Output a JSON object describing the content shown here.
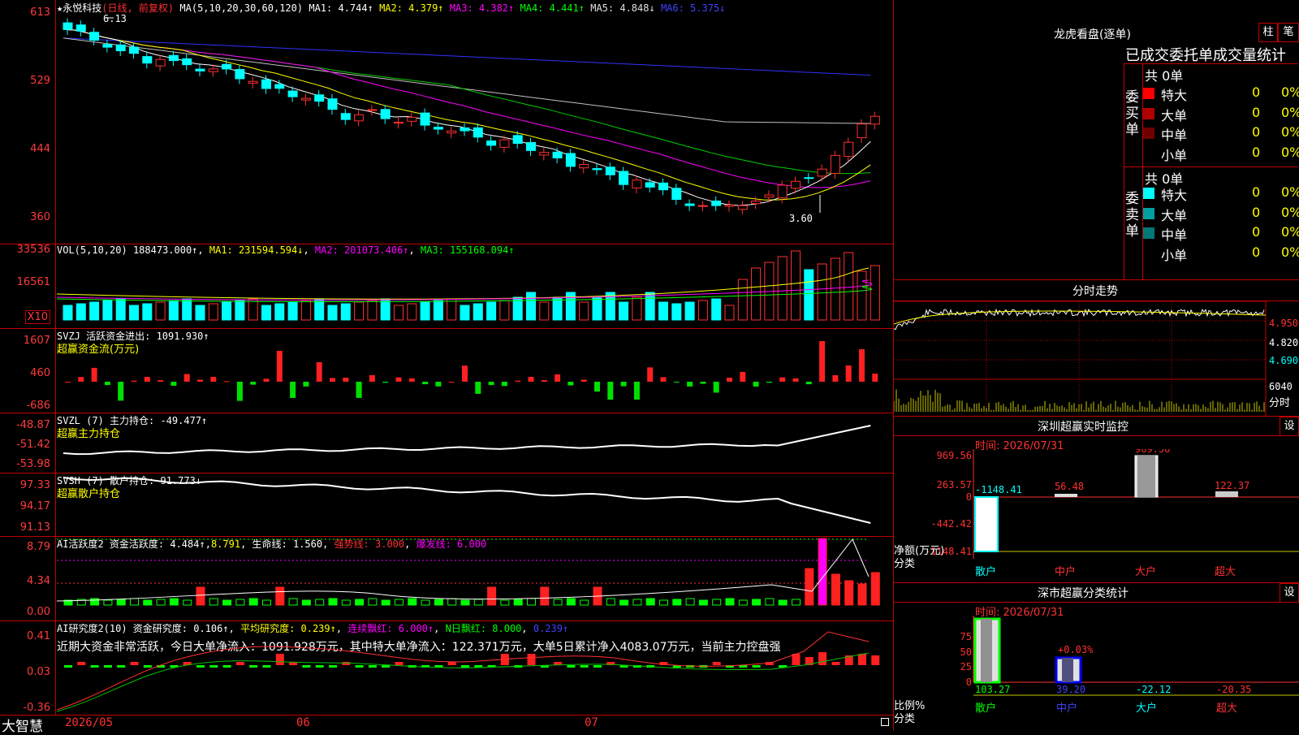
{
  "price_panel": {
    "title_star": "★",
    "stock_name": "永悦科技",
    "period": "(日线, 前复权)",
    "ma_label": "MA(5,10,20,30,60,120)",
    "ma1": "MA1: 4.744↑",
    "ma2": "MA2: 4.379↑",
    "ma3": "MA3: 4.382↑",
    "ma4": "MA4: 4.441↑",
    "ma5": "MA5: 4.848↓",
    "ma6": "MA6: 5.375↓",
    "high_mark": "6.13",
    "low_mark": "3.60",
    "y_labels": [
      "613",
      "529",
      "444",
      "360"
    ]
  },
  "vol_panel": {
    "label": "VOL(5,10,20)",
    "value": "188473.000↑",
    "ma1": "MA1: 231594.594↓",
    "ma2": "MA2: 201073.406↑",
    "ma3": "MA3: 155168.094↑",
    "y_labels": [
      "33536",
      "16561"
    ],
    "unit": "X10"
  },
  "svzj_panel": {
    "label": "SVZJ  活跃资金进出: 1091.930↑",
    "subtitle": "超赢资金流(万元)",
    "y_labels": [
      "1607",
      "460",
      "-686"
    ]
  },
  "svzl_panel": {
    "label": "SVZL (7) 主力持仓: -49.477↑",
    "subtitle": "超赢主力持仓",
    "y_labels": [
      "-48.87",
      "-51.42",
      "-53.98"
    ]
  },
  "svsh_panel": {
    "label": "SVSH (7) 散户持仓: 91.773↓",
    "subtitle": "超赢散户持仓",
    "y_labels": [
      "97.33",
      "94.17",
      "91.13"
    ]
  },
  "ai_active": {
    "label": "AI活跃度2 资金活跃度: 4.484↑",
    "v2": "8.791",
    "v3": "生命线: 1.560",
    "v4": "强势线: 3.000",
    "v5": "爆发线: 6.000",
    "y_labels": [
      "8.79",
      "4.34",
      "0.00"
    ]
  },
  "ai_research": {
    "label": "AI研究度2(10) 资金研究度: 0.106↑",
    "v2": "平均研究度: 0.239↑",
    "v3": "连续飘红: 6.000↑",
    "v4": "N日飘红: 8.000",
    "v5": "0.239↑",
    "comment": "近期大资金非常活跃，今日大单净流入：1091.928万元，其中特大单净流入：122.371万元，大单5日累计净入4083.07万元，当前主力控盘强",
    "y_labels": [
      "0.41",
      "0.03",
      "-0.36"
    ]
  },
  "bottom_bar": {
    "brand": "大智慧",
    "dates": [
      "2026/05",
      "06",
      "07"
    ]
  },
  "longhu": {
    "title": "龙虎看盘(逐单)",
    "btn1": "柱",
    "btn2": "笔",
    "stat_title": "已成交委托单成交量统计",
    "buy_group": "委买单",
    "sell_group": "委卖单",
    "buy_total": "共 0单",
    "sell_total": "共 0单",
    "rows_buy": [
      {
        "label": "特大",
        "count": "0",
        "pct": "0%",
        "color": "#ff0000"
      },
      {
        "label": "大单",
        "count": "0",
        "pct": "0%",
        "color": "#b00000"
      },
      {
        "label": "中单",
        "count": "0",
        "pct": "0%",
        "color": "#700000"
      },
      {
        "label": "小单",
        "count": "0",
        "pct": "0%",
        "color": "#000000"
      }
    ],
    "rows_sell": [
      {
        "label": "特大",
        "count": "0",
        "pct": "0%",
        "color": "#00ffff"
      },
      {
        "label": "大单",
        "count": "0",
        "pct": "0%",
        "color": "#00a0a0"
      },
      {
        "label": "中单",
        "count": "0",
        "pct": "0%",
        "color": "#007878"
      },
      {
        "label": "小单",
        "count": "0",
        "pct": "0%",
        "color": "#000000"
      }
    ]
  },
  "intraday": {
    "title": "分时走势",
    "price_labels": [
      "4.950",
      "4.820",
      "4.690"
    ],
    "vol_label": "6040",
    "vol_unit": "分时"
  },
  "sz_monitor": {
    "title": "深圳超赢实时监控",
    "btn": "设",
    "time": "时间: 2026/07/31",
    "y_labels": [
      "969.56",
      "263.57",
      "0",
      "-442.42",
      "-1148.41"
    ],
    "y_axis_label": "净额(万元)",
    "x_axis_label": "分类",
    "categories": [
      "散户",
      "中户",
      "大户",
      "超大"
    ],
    "bar_labels": [
      "-1148.41",
      "56.48",
      "969.56",
      "122.37"
    ]
  },
  "sz_class": {
    "title": "深市超赢分类统计",
    "btn": "设",
    "time": "时间: 2026/07/31",
    "y_labels": [
      "75",
      "50",
      "25",
      "0"
    ],
    "y_axis_label": "比例%",
    "x_axis_label": "分类",
    "top_label": "+0.03%",
    "categories": [
      "散户",
      "中户",
      "大户",
      "超大"
    ],
    "values": [
      "103.27",
      "39.20",
      "-22.12",
      "-20.35"
    ]
  }
}
